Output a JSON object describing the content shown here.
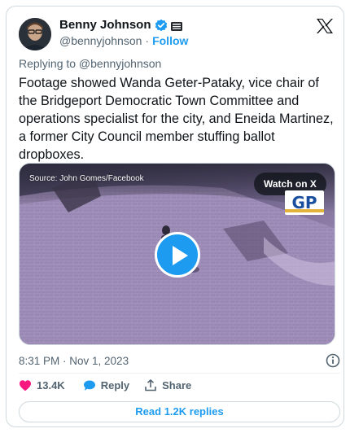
{
  "author": {
    "display_name": "Benny Johnson",
    "handle": "@bennyjohnson",
    "follow_label": "Follow",
    "separator": "·"
  },
  "tweet": {
    "replying_to": "Replying to @bennyjohnson",
    "text": "Footage showed Wanda Geter-Pataky, vice chair of the Bridgeport Democratic Town Committee and operations specialist for the city, and Eneida Martinez, a former City Council member stuffing ballot dropboxes.",
    "timestamp": "8:31 PM · Nov 1, 2023"
  },
  "media": {
    "source_label": "Source: John Gomes/Facebook",
    "watch_label": "Watch on X",
    "logo_text": "GP"
  },
  "actions": {
    "likes": "13.4K",
    "reply_label": "Reply",
    "share_label": "Share"
  },
  "read_replies_label": "Read 1.2K replies",
  "colors": {
    "accent": "#1d9bf0",
    "like": "#f91880",
    "text_primary": "#0f1419",
    "text_secondary": "#536471",
    "border": "#cfd9de"
  },
  "icons": [
    "verified-icon",
    "gov-badge-icon",
    "x-logo-icon",
    "play-icon",
    "info-icon",
    "heart-icon",
    "reply-icon",
    "share-icon"
  ]
}
